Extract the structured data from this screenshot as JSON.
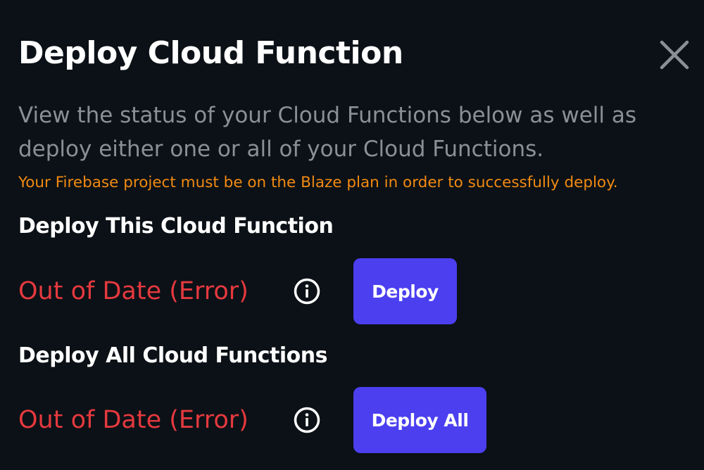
{
  "dialog": {
    "title": "Deploy Cloud Function",
    "close_icon": "close-x-icon",
    "description": "View the status of your Cloud Functions below as well as deploy either one or all of your Cloud Functions.",
    "warning": "Your Firebase project must be on the Blaze plan in order to successfully deploy."
  },
  "sections": [
    {
      "heading": "Deploy This Cloud Function",
      "status": "Out of Date (Error)",
      "info_icon": "info-circle-icon",
      "button_label": "Deploy"
    },
    {
      "heading": "Deploy All Cloud Functions",
      "status": "Out of Date (Error)",
      "info_icon": "info-circle-icon",
      "button_label": "Deploy All"
    }
  ],
  "colors": {
    "background": "#0b1116",
    "title": "#ffffff",
    "description": "#8a9096",
    "warning": "#f28a12",
    "status_error": "#e5393f",
    "button": "#4b3ff0"
  }
}
